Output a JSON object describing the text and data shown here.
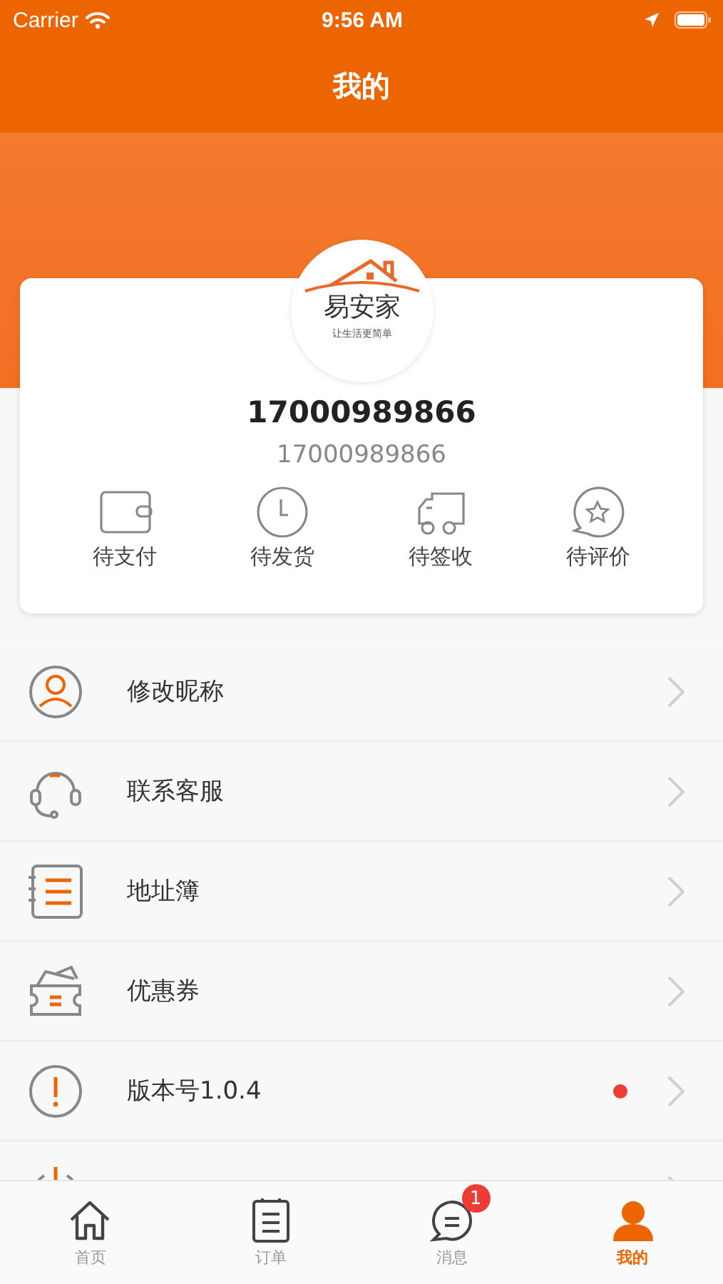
{
  "status_bar": {
    "carrier": "Carrier",
    "time": "9:56 AM"
  },
  "nav": {
    "title": "我的"
  },
  "profile": {
    "logo_name": "易安家",
    "logo_slogan": "让生活更简单",
    "name": "17000989866",
    "account": "17000989866"
  },
  "orders": [
    {
      "label": "待支付"
    },
    {
      "label": "待发货"
    },
    {
      "label": "待签收"
    },
    {
      "label": "待评价"
    }
  ],
  "menu": [
    {
      "label": "修改昵称",
      "dot": false
    },
    {
      "label": "联系客服",
      "dot": false
    },
    {
      "label": "地址簿",
      "dot": false
    },
    {
      "label": "优惠券",
      "dot": false
    },
    {
      "label": "版本号1.0.4",
      "dot": true
    },
    {
      "dot": false
    }
  ],
  "tabs": [
    {
      "label": "首页",
      "selected": false
    },
    {
      "label": "订单",
      "selected": false
    },
    {
      "label": "消息",
      "selected": false,
      "badge": "1"
    },
    {
      "label": "我的",
      "selected": true
    }
  ]
}
